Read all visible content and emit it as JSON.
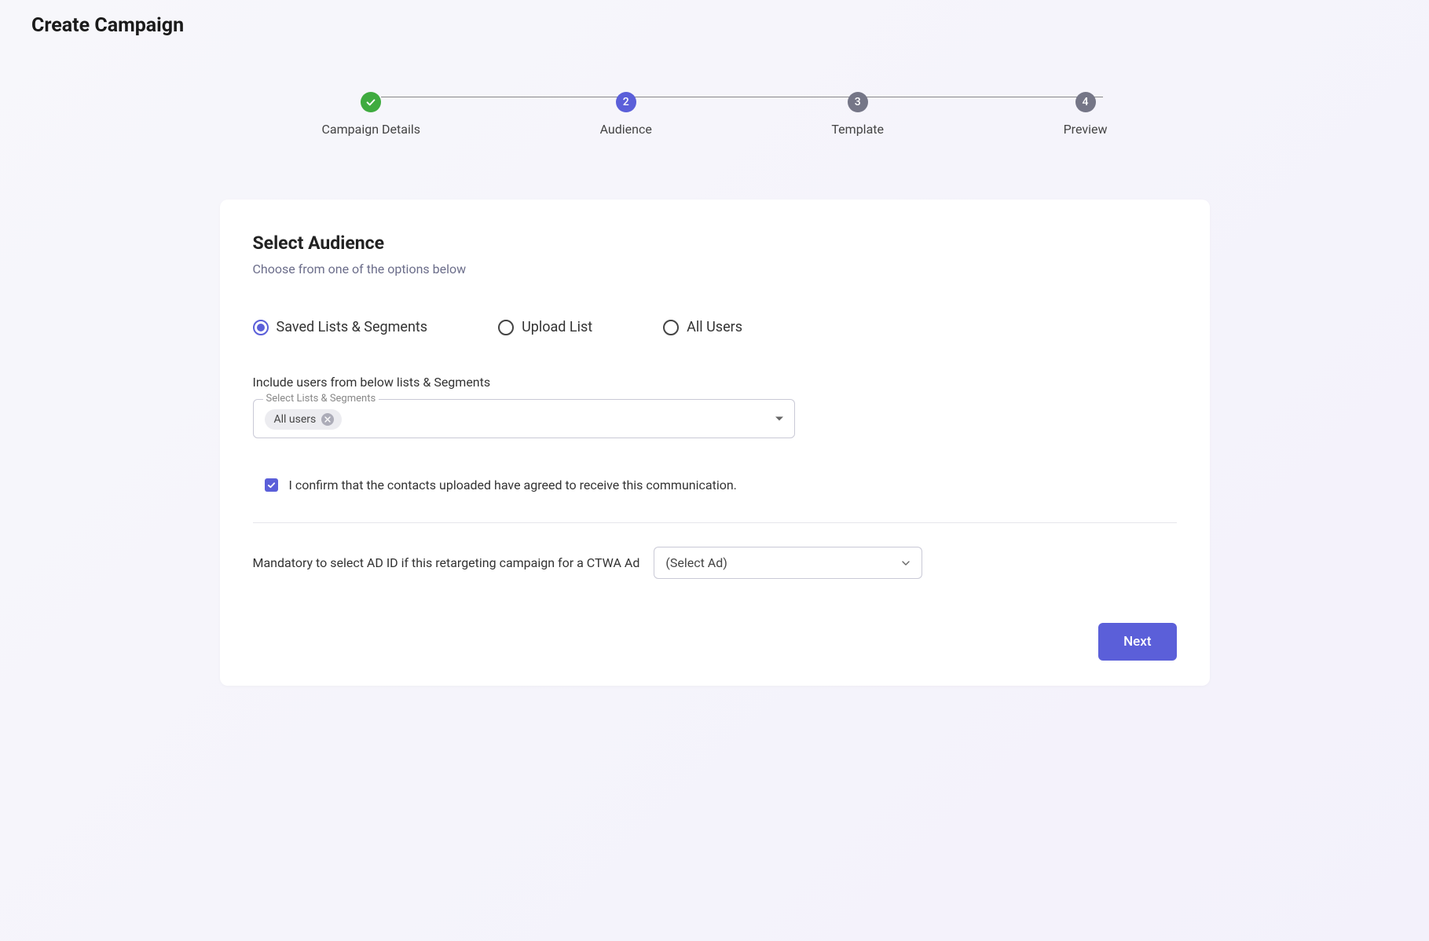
{
  "page_title": "Create Campaign",
  "stepper": {
    "steps": [
      {
        "label": "Campaign Details",
        "state": "completed"
      },
      {
        "label": "Audience",
        "state": "active",
        "num": "2"
      },
      {
        "label": "Template",
        "state": "pending",
        "num": "3"
      },
      {
        "label": "Preview",
        "state": "pending",
        "num": "4"
      }
    ]
  },
  "section": {
    "title": "Select Audience",
    "subtitle": "Choose from one of the options below"
  },
  "radios": {
    "opt1": "Saved Lists & Segments",
    "opt2": "Upload List",
    "opt3": "All Users"
  },
  "include_label": "Include users from below lists & Segments",
  "select_legend": "Select Lists & Segments",
  "chip_label": "All users",
  "confirm_text": "I confirm that the contacts uploaded have agreed to receive this communication.",
  "ad_label": "Mandatory to select AD ID if this retargeting campaign for a CTWA Ad",
  "ad_placeholder": "(Select Ad)",
  "next_label": "Next"
}
